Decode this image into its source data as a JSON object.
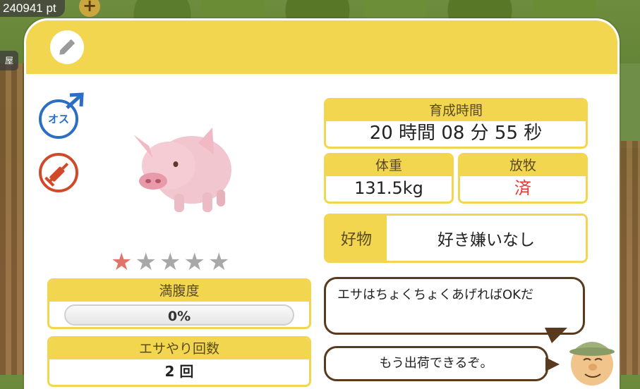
{
  "hud": {
    "points_text": "240941 pt",
    "plus_label": "+",
    "side_tab_label": "屋"
  },
  "badges": {
    "gender_label": "オス",
    "gender_icon": "male-symbol-icon",
    "vaccine_icon": "syringe-icon",
    "gender_color": "#2b6fc4",
    "vaccine_color": "#d04a2a"
  },
  "rating": {
    "stars": [
      1,
      0,
      0,
      0,
      0
    ],
    "star_glyph": "★"
  },
  "fullness": {
    "label": "満腹度",
    "value_text": "0%",
    "value": 0
  },
  "feeding": {
    "label": "エサやり回数",
    "value_text": "2 回"
  },
  "growth_time": {
    "label": "育成時間",
    "value_text": "20 時間 08 分 55 秒"
  },
  "weight": {
    "label": "体重",
    "value_text": "131.5kg"
  },
  "grazing": {
    "label": "放牧",
    "value_text": "済"
  },
  "favorite": {
    "label": "好物",
    "value_text": "好き嫌いなし"
  },
  "dialogue": {
    "line1": "エサはちょくちょくあげればOKだ",
    "line2": "もう出荷できるぞ。"
  },
  "colors": {
    "header_yellow": "#f3d650",
    "bubble_border": "#5a3a1e",
    "grazing_done": "#e2392b",
    "star_on": "#e0746a",
    "star_off": "#a8a8a8"
  }
}
